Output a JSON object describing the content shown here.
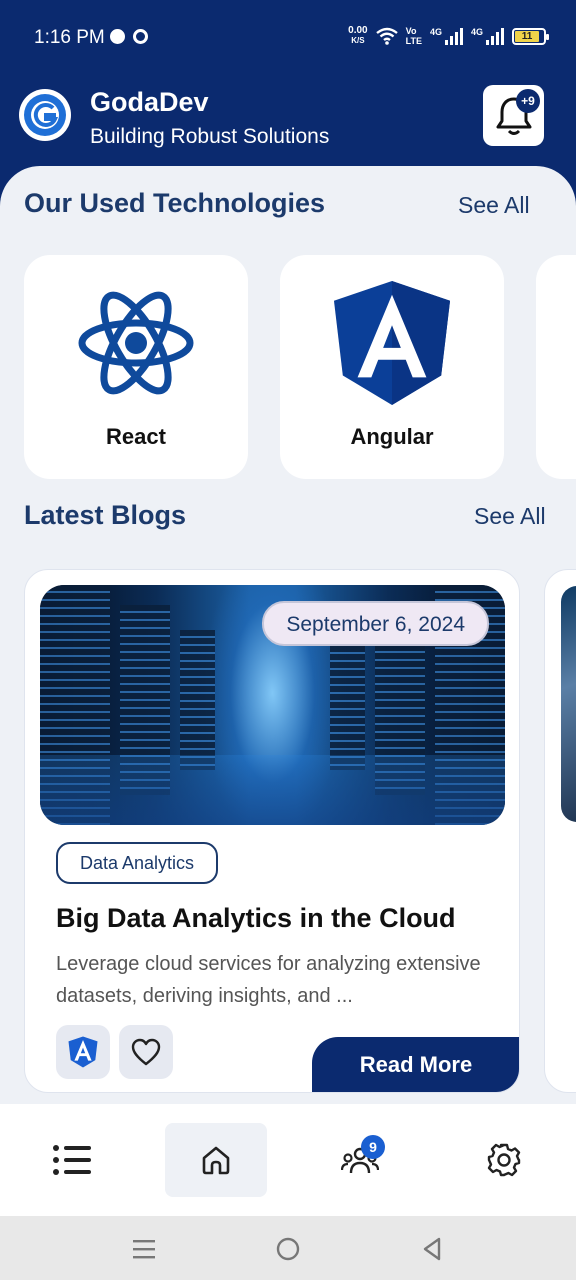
{
  "status_bar": {
    "time": "1:16 PM",
    "net_speed_value": "0.00",
    "net_speed_unit": "K/S",
    "volte_top": "Vo",
    "volte_bottom": "LTE",
    "signal1_label": "4G",
    "signal2_label": "4G",
    "battery_level": "11"
  },
  "header": {
    "app_name": "GodaDev",
    "tagline": "Building Robust Solutions",
    "notification_badge": "+9"
  },
  "technologies": {
    "title": "Our Used Technologies",
    "see_all": "See All",
    "items": [
      {
        "label": "React",
        "icon": "react-icon"
      },
      {
        "label": "Angular",
        "icon": "angular-icon"
      }
    ]
  },
  "blogs": {
    "title": "Latest Blogs",
    "see_all": "See All",
    "items": [
      {
        "date": "September 6, 2024",
        "category": "Data Analytics",
        "title": "Big Data Analytics in the Cloud",
        "excerpt": "Leverage cloud services for analyzing extensive datasets, deriving insights, and ...",
        "read_more": "Read More"
      }
    ]
  },
  "bottom_nav": {
    "items": [
      {
        "name": "list",
        "icon": "list-icon"
      },
      {
        "name": "home",
        "icon": "home-icon",
        "active": true
      },
      {
        "name": "team",
        "icon": "team-icon",
        "badge": "9"
      },
      {
        "name": "settings",
        "icon": "gear-icon"
      }
    ]
  },
  "colors": {
    "brand": "#0b2a6f",
    "heading": "#1c3a6b",
    "background": "#eef1f6",
    "badge": "#1a5fd1"
  }
}
